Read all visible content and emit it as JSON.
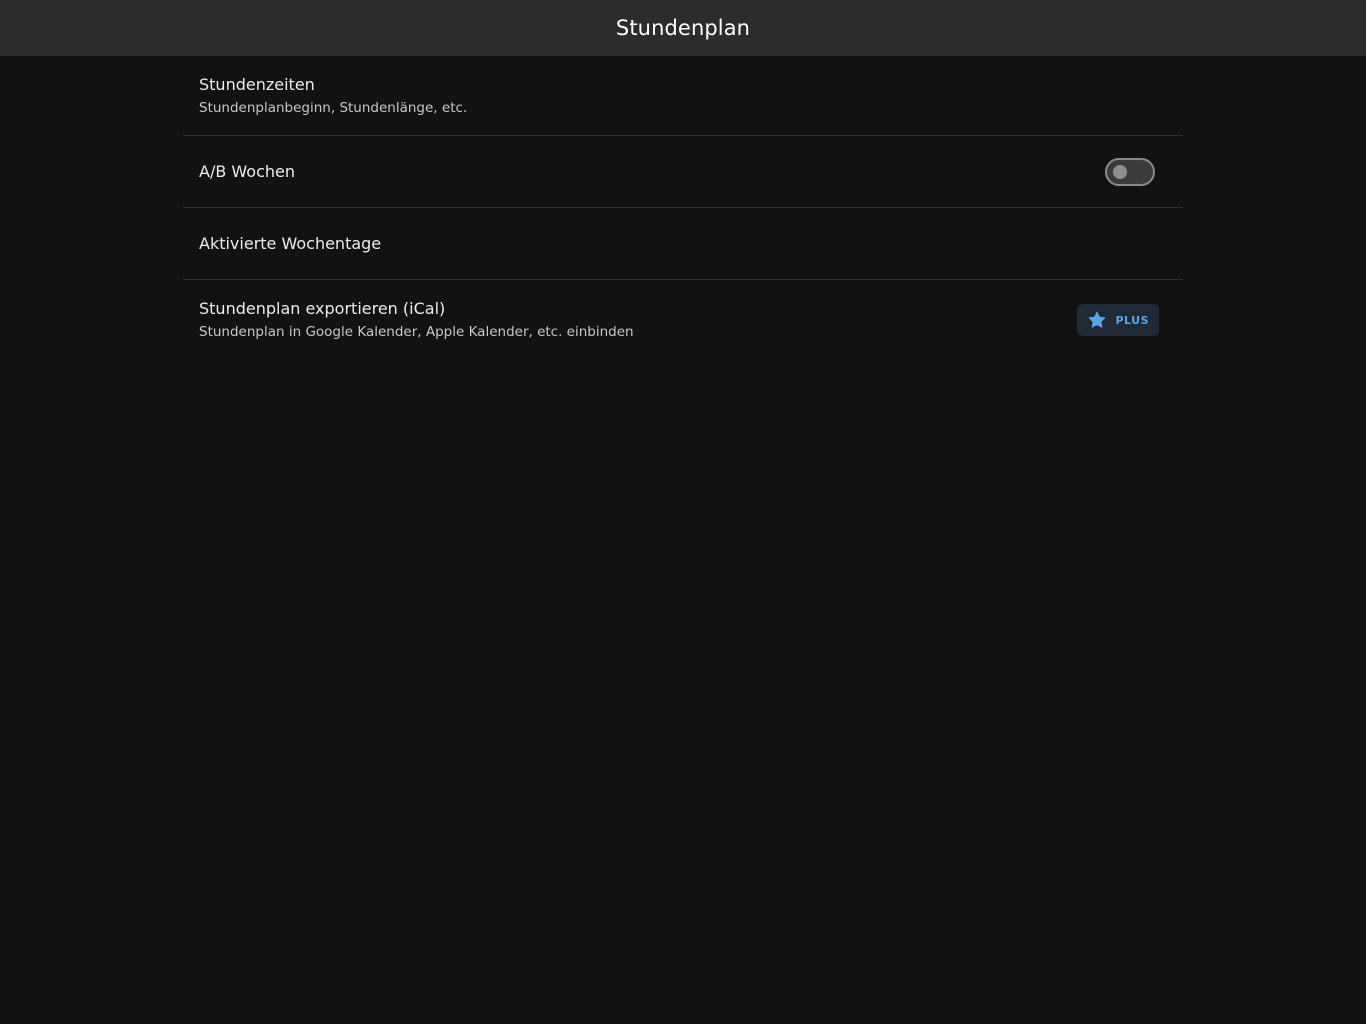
{
  "header": {
    "title": "Stundenplan"
  },
  "settings": {
    "items": [
      {
        "title": "Stundenzeiten",
        "subtitle": "Stundenplanbeginn, Stundenlänge, etc."
      },
      {
        "title": "A/B Wochen",
        "toggle_state": "off"
      },
      {
        "title": "Aktivierte Wochentage"
      },
      {
        "title": "Stundenplan exportieren (iCal)",
        "subtitle": "Stundenplan in Google Kalender, Apple Kalender, etc. einbinden",
        "badge": {
          "label": "PLUS",
          "icon": "star-icon"
        }
      }
    ]
  },
  "colors": {
    "background": "#121212",
    "topbar": "#2c2c2c",
    "accent": "#5aa3e6",
    "badge_bg": "#1f2a36"
  }
}
